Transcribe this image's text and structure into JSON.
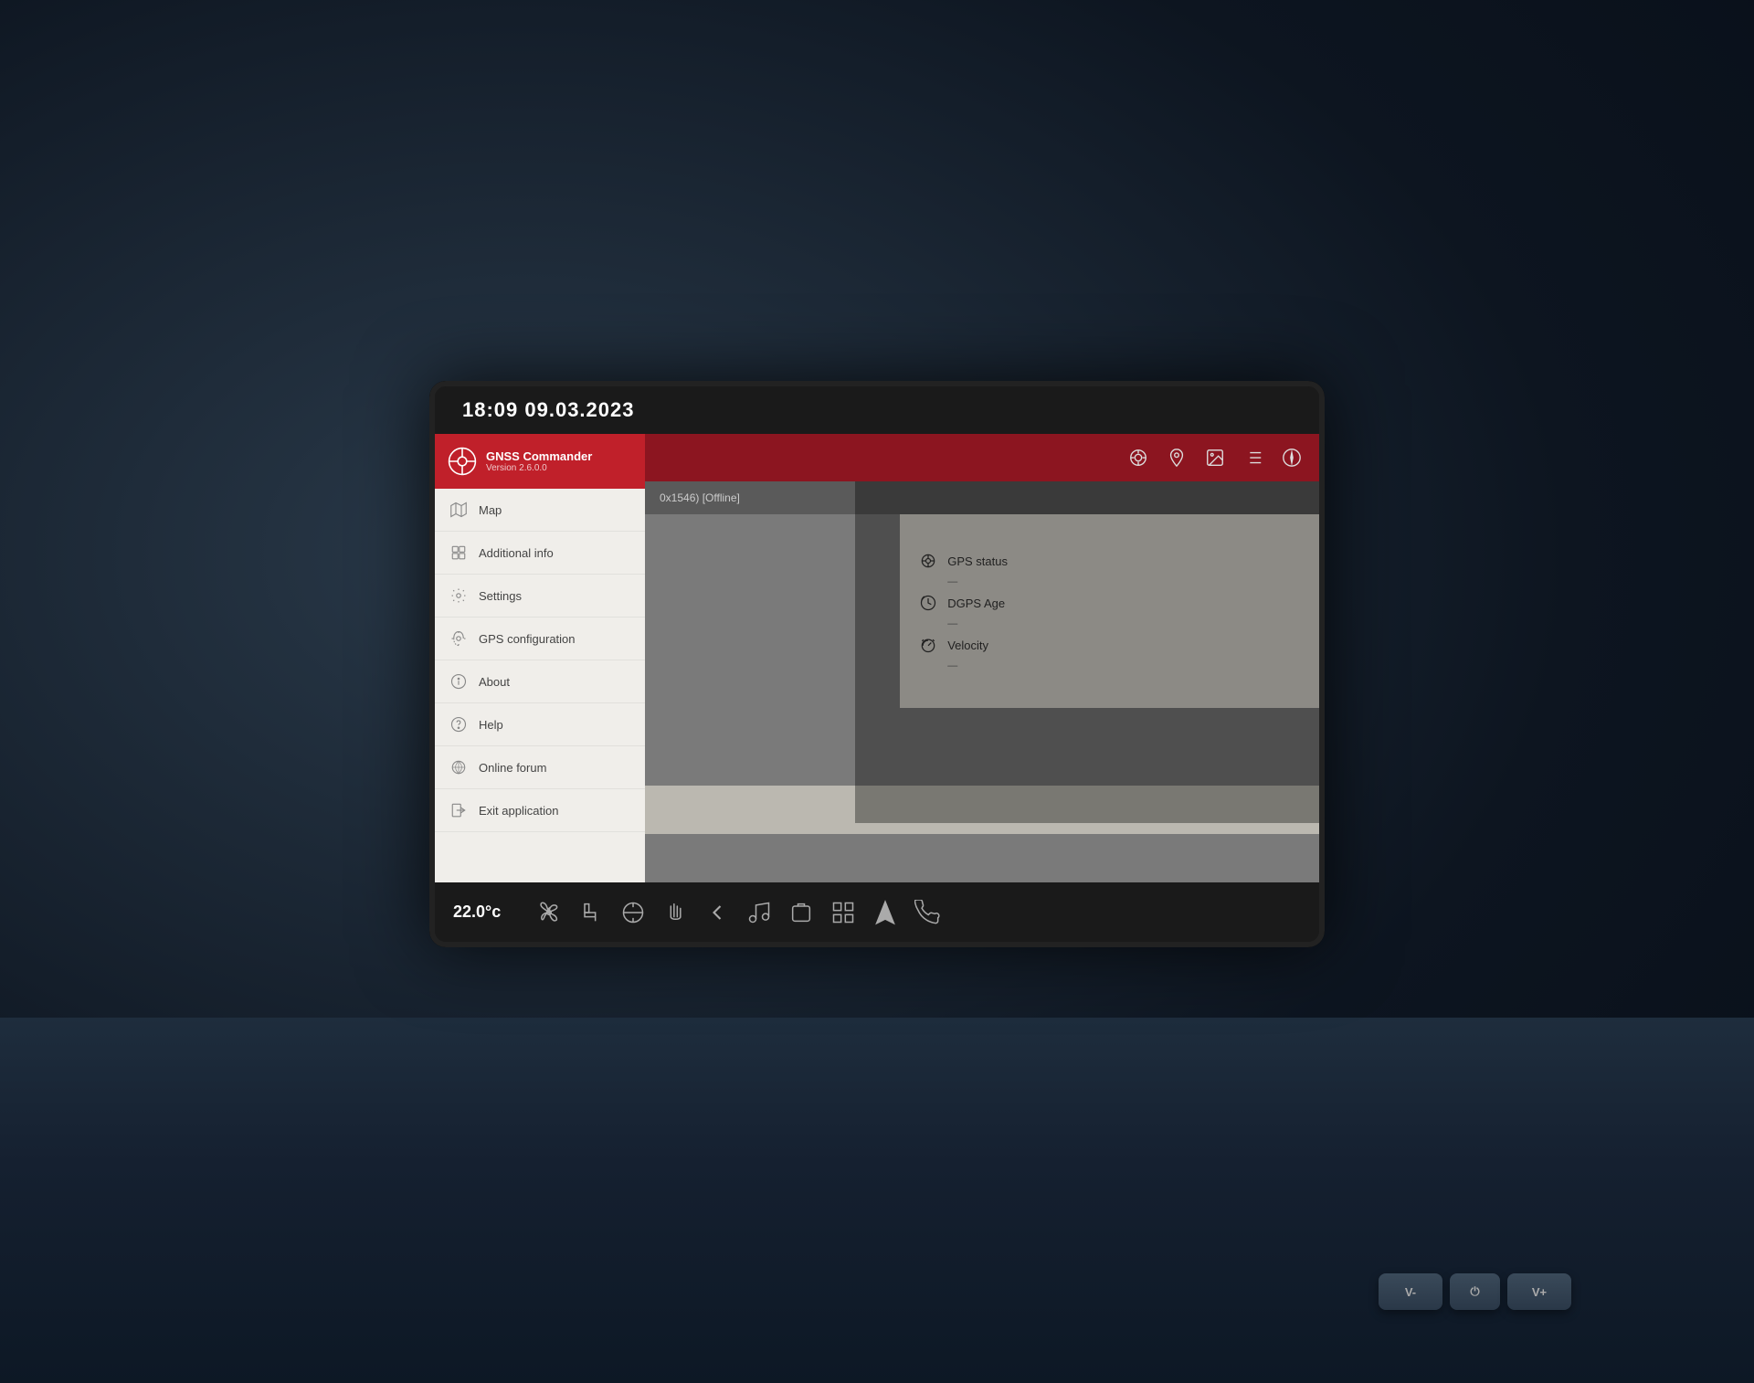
{
  "datetime": {
    "time": "18:09",
    "date": "09.03.2023",
    "display": "18:09  09.03.2023"
  },
  "app": {
    "name": "GNSS Commander",
    "version": "Version 2.6.0.0"
  },
  "menu": {
    "items": [
      {
        "id": "map",
        "label": "Map",
        "icon": "map"
      },
      {
        "id": "additional-info",
        "label": "Additional info",
        "icon": "grid"
      },
      {
        "id": "settings",
        "label": "Settings",
        "icon": "gear"
      },
      {
        "id": "gps-configuration",
        "label": "GPS configuration",
        "icon": "gps-config"
      },
      {
        "id": "about",
        "label": "About",
        "icon": "info"
      },
      {
        "id": "help",
        "label": "Help",
        "icon": "help"
      },
      {
        "id": "online-forum",
        "label": "Online forum",
        "icon": "forum"
      },
      {
        "id": "exit-application",
        "label": "Exit application",
        "icon": "exit"
      }
    ]
  },
  "toolbar": {
    "icons": [
      "target",
      "location-pin",
      "image",
      "list",
      "compass"
    ]
  },
  "status": {
    "text": "0x1546) [Offline]"
  },
  "gps_info": [
    {
      "label": "GPS status",
      "value": "—",
      "icon": "gps"
    },
    {
      "label": "DGPS Age",
      "value": "—",
      "icon": "clock"
    },
    {
      "label": "Velocity",
      "value": "—",
      "icon": "velocity"
    }
  ],
  "bottom_bar": {
    "temperature": "22.0°c",
    "icons": [
      "fan",
      "seat",
      "steering-heat",
      "gesture",
      "back",
      "music",
      "phone",
      "grid",
      "navigation",
      "call"
    ]
  },
  "physical_buttons": [
    {
      "label": "V-"
    },
    {
      "label": "⏻",
      "mid": true
    },
    {
      "label": "V+"
    }
  ]
}
